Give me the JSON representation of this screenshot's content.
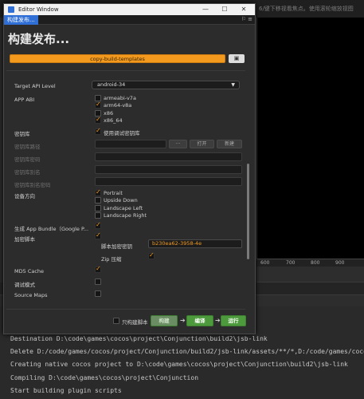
{
  "background": {
    "top_text": "6/键下移视看焦点。使用滚轮缩放视图",
    "ruler_ticks": [
      "600",
      "700",
      "800",
      "900"
    ],
    "console": [
      "Destination D:\\code\\games\\cocos\\project\\Conjunction\\build2\\jsb-link",
      "Delete D:/code/games/cocos/project/Conjunction/build2/jsb-link/assets/**/*,D:/code/games/cocos/",
      "Creating native cocos project to D:\\code\\games\\cocos\\project\\Conjunction\\build2\\jsb-link",
      "Compiling D:\\code\\games\\cocos\\project\\Conjunction",
      "Start building plugin scripts"
    ]
  },
  "window": {
    "title": "Editor Window",
    "minimize": "—",
    "maximize": "☐",
    "close": "✕",
    "tab": "构建发布...",
    "tab_tools": "⚐ ≡",
    "heading": "构建发布...",
    "template_button": "copy-build-templates",
    "template_side_icon": "▣"
  },
  "settings": {
    "target_api_label": "Target API Level",
    "target_api_value": "android-34",
    "app_abi_label": "APP ABI",
    "abis": [
      {
        "label": "armeabi-v7a",
        "checked": false
      },
      {
        "label": "arm64-v8a",
        "checked": true
      },
      {
        "label": "x86",
        "checked": false
      },
      {
        "label": "x86_64",
        "checked": true
      }
    ],
    "keystore_label": "密钥库",
    "keystore_debug": "使用调试密钥库",
    "keystore_path_label": "密钥库路径",
    "keystore_dots": "···",
    "keystore_open": "打开",
    "keystore_new": "新建",
    "keystore_password_label": "密钥库密码",
    "keystore_alias_label": "密钥库别名",
    "keystore_alias_password_label": "密钥库别名密码",
    "orientation_label": "设备方向",
    "orientations": [
      {
        "label": "Portrait",
        "checked": true
      },
      {
        "label": "Upside Down",
        "checked": false
      },
      {
        "label": "Landscape Left",
        "checked": false
      },
      {
        "label": "Landscape Right",
        "checked": false
      }
    ],
    "app_bundle_label": "生成 App Bundle（Google P...",
    "encrypt_label": "加密脚本",
    "encrypt_key_label": "脚本加密密钥",
    "encrypt_key_value": "b230ea62-3958-4e",
    "zip_label": "Zip 压缩",
    "md5_label": "MD5 Cache",
    "debug_label": "调试模式",
    "sourcemaps_label": "Source Maps"
  },
  "footer": {
    "only_script_label": "只构建脚本",
    "build": "构建",
    "compile": "编译",
    "run": "运行",
    "arrow": "➔"
  }
}
